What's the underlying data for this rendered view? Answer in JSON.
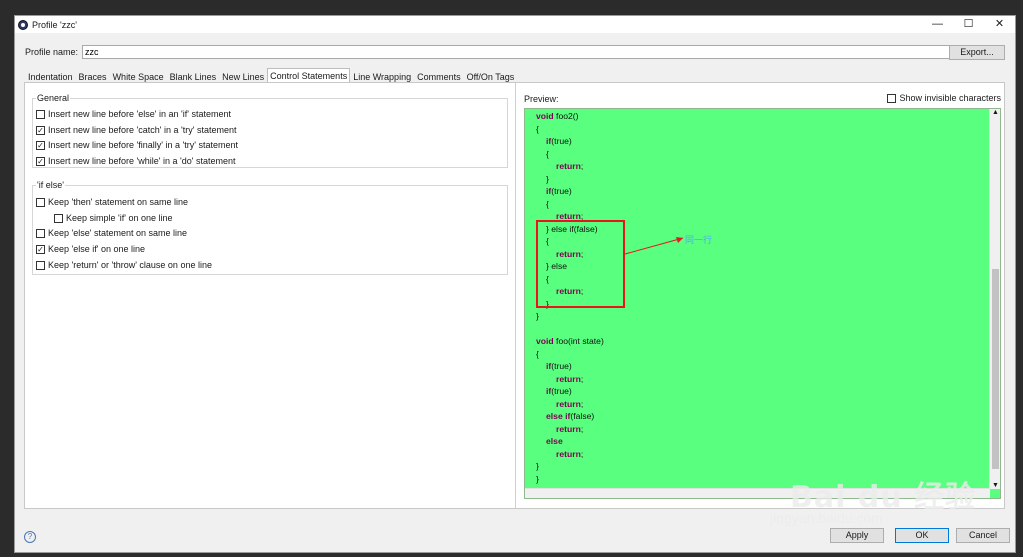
{
  "window": {
    "title": "Profile 'zzc'",
    "controls": [
      "—",
      "☐",
      "✕"
    ]
  },
  "profile": {
    "label": "Profile name:",
    "value": "zzc",
    "export_label": "Export..."
  },
  "tabs": [
    "Indentation",
    "Braces",
    "White Space",
    "Blank Lines",
    "New Lines",
    "Control Statements",
    "Line Wrapping",
    "Comments",
    "Off/On Tags"
  ],
  "active_tab": "Control Statements",
  "general": {
    "title": "General",
    "options": [
      {
        "label": "Insert new line before 'else' in an 'if' statement",
        "checked": false,
        "mark": ""
      },
      {
        "label": "Insert new line before 'catch' in a 'try' statement",
        "checked": true,
        "mark": "✓"
      },
      {
        "label": "Insert new line before 'finally' in a 'try' statement",
        "checked": true,
        "mark": "✓"
      },
      {
        "label": "Insert new line before 'while' in a 'do' statement",
        "checked": true,
        "mark": "✓"
      }
    ]
  },
  "if_else": {
    "title": "'if else'",
    "options": [
      {
        "label": "Keep 'then' statement on same line",
        "checked": false,
        "mark": ""
      },
      {
        "label": "Keep simple 'if' on one line",
        "checked": false,
        "mark": ""
      },
      {
        "label": "Keep 'else' statement on same line",
        "checked": false,
        "mark": ""
      },
      {
        "label": "Keep 'else if' on one line",
        "checked": true,
        "mark": "✓"
      },
      {
        "label": "Keep 'return' or 'throw' clause on one line",
        "checked": false,
        "mark": ""
      }
    ]
  },
  "preview": {
    "label": "Preview:",
    "show_invisible": "Show invisible characters",
    "bg_color": "#59ff7e",
    "lines": [
      {
        "indent": 0,
        "kw": "void",
        "rest": " foo2()"
      },
      {
        "indent": 0,
        "kw": "",
        "rest": "{"
      },
      {
        "indent": 1,
        "kw": "if",
        "rest": "(true)"
      },
      {
        "indent": 1,
        "kw": "",
        "rest": "{"
      },
      {
        "indent": 2,
        "kw": "return",
        "rest": ";"
      },
      {
        "indent": 1,
        "kw": "",
        "rest": "}"
      },
      {
        "indent": 1,
        "kw": "if",
        "rest": "(true)"
      },
      {
        "indent": 1,
        "kw": "",
        "rest": "{"
      },
      {
        "indent": 2,
        "kw": "return",
        "rest": ";"
      },
      {
        "indent": 1,
        "kw": "",
        "rest": "} else if(false)"
      },
      {
        "indent": 1,
        "kw": "",
        "rest": "{"
      },
      {
        "indent": 2,
        "kw": "return",
        "rest": ";"
      },
      {
        "indent": 1,
        "kw": "",
        "rest": "} else"
      },
      {
        "indent": 1,
        "kw": "",
        "rest": "{"
      },
      {
        "indent": 2,
        "kw": "return",
        "rest": ";"
      },
      {
        "indent": 1,
        "kw": "",
        "rest": "}"
      },
      {
        "indent": 0,
        "kw": "",
        "rest": "}"
      },
      {
        "indent": 0,
        "kw": "",
        "rest": ""
      },
      {
        "indent": 0,
        "kw": "void",
        "rest": " foo(int state)"
      },
      {
        "indent": 0,
        "kw": "",
        "rest": "{"
      },
      {
        "indent": 1,
        "kw": "if",
        "rest": "(true)"
      },
      {
        "indent": 2,
        "kw": "return",
        "rest": ";"
      },
      {
        "indent": 1,
        "kw": "if",
        "rest": "(true)"
      },
      {
        "indent": 2,
        "kw": "return",
        "rest": ";"
      },
      {
        "indent": 1,
        "kw": "else if",
        "rest": "(false)"
      },
      {
        "indent": 2,
        "kw": "return",
        "rest": ";"
      },
      {
        "indent": 1,
        "kw": "else",
        "rest": ""
      },
      {
        "indent": 2,
        "kw": "return",
        "rest": ";"
      },
      {
        "indent": 0,
        "kw": "",
        "rest": "}"
      },
      {
        "indent": 0,
        "kw": "",
        "rest": "}"
      }
    ],
    "annotation_text": "同一行",
    "highlight_color": "#e8141e"
  },
  "footer": {
    "help": "?",
    "apply": "Apply",
    "ok": "OK",
    "cancel": "Cancel"
  },
  "watermark": {
    "brand": "Bai du 经验",
    "url": "jingyan.baidu.com"
  }
}
